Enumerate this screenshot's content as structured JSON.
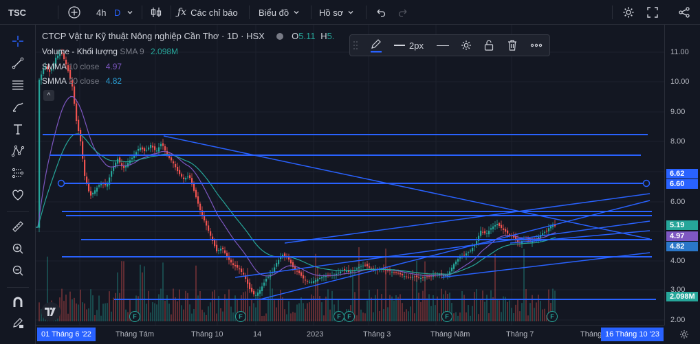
{
  "header": {
    "symbol": "TSC",
    "add_label": "+",
    "interval": "4h",
    "interval_mode": "D",
    "indicators_label": "Các chỉ báo",
    "chart_type_label": "Biểu đồ",
    "profile_label": "Hồ sơ"
  },
  "legend": {
    "title": "CTCP Vật tư Kỹ thuật Nông nghiệp Cần Thơ · 1D · HSX",
    "open_label": "O",
    "open_value": "5.11",
    "high_label": "H",
    "high_value": "5.",
    "volume_label": "Volume - Khối lượng",
    "volume_ma": "SMA 9",
    "volume_value": "2.098M",
    "smma10_label": "SMMA",
    "smma10_param": "10 close",
    "smma10_value": "4.97",
    "smma20_label": "SMMA",
    "smma20_param": "20 close",
    "smma20_value": "4.82",
    "collapse_glyph": "^"
  },
  "drawing_toolbar": {
    "width_label": "2px"
  },
  "price_scale": {
    "ticks": [
      "11.00",
      "10.00",
      "9.00",
      "8.00",
      "6.00",
      "4.00",
      "3.00",
      "2.00"
    ],
    "tags": [
      {
        "value": "6.62",
        "color": "#2962ff"
      },
      {
        "value": "6.60",
        "color": "#2962ff"
      },
      {
        "value": "5.19",
        "color": "#26a69a"
      },
      {
        "value": "4.97",
        "color": "#7e57c2"
      },
      {
        "value": "4.82",
        "color": "#2a77c9"
      },
      {
        "value": "2.098M",
        "color": "#26a69a"
      }
    ]
  },
  "time_scale": {
    "start_label": "01 Tháng 6 '22",
    "labels": [
      "Tháng Tám",
      "Tháng 10",
      "14",
      "2023",
      "Tháng 3",
      "Tháng Năm",
      "Tháng 7",
      "Tháng"
    ],
    "end_label": "16 Tháng 10 '23"
  },
  "events": {
    "badge": "F"
  },
  "colors": {
    "background": "#131722",
    "up": "#26a69a",
    "down": "#ef5350",
    "drawing": "#2962ff",
    "smma10": "#7e57c2",
    "smma20": "#26a69a"
  }
}
